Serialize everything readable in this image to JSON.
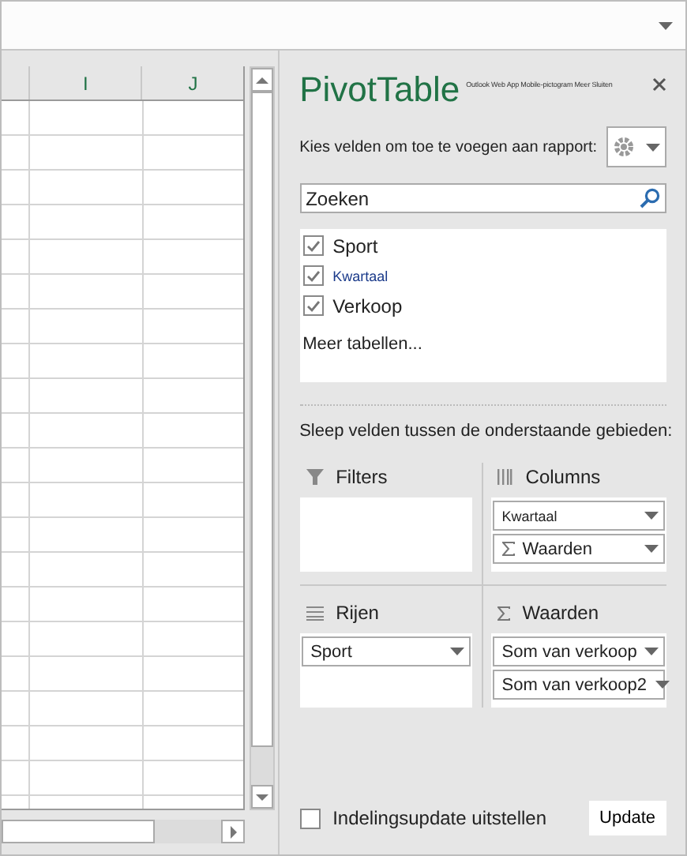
{
  "sheet": {
    "columns": [
      "I",
      "J"
    ]
  },
  "panel": {
    "title": "PivotTable",
    "header_links": "Outlook Web App Mobile-pictogram Meer Sluiten",
    "instruction": "Kies velden om toe te voegen aan rapport:",
    "search": {
      "placeholder": "Zoeken"
    },
    "fields": [
      {
        "label": "Sport",
        "checked": true,
        "kind": "normal"
      },
      {
        "label": "Kwartaal",
        "checked": true,
        "kind": "small"
      },
      {
        "label": "Verkoop",
        "checked": true,
        "kind": "normal"
      }
    ],
    "more_tables": "Meer tabellen...",
    "areas_instruction": "Sleep velden tussen de onderstaande gebieden:",
    "areas": [
      {
        "kind": "filters",
        "label": "Filters"
      },
      {
        "kind": "columns",
        "label": "Columns",
        "items": [
          {
            "label": "Kwartaal",
            "kind": "small"
          },
          {
            "label": "Waarden",
            "kind": "sigma"
          }
        ]
      },
      {
        "kind": "rows",
        "label": "Rijen",
        "items": [
          {
            "label": "Sport",
            "kind": "normal"
          }
        ]
      },
      {
        "kind": "values",
        "label": "Waarden",
        "items": [
          {
            "label": "Som van verkoop",
            "kind": "normal"
          },
          {
            "label": "Som van verkoop2",
            "kind": "normal"
          }
        ]
      }
    ],
    "defer": {
      "label": "Indelingsupdate uitstellen",
      "checked": false
    },
    "update_button": "Update"
  }
}
